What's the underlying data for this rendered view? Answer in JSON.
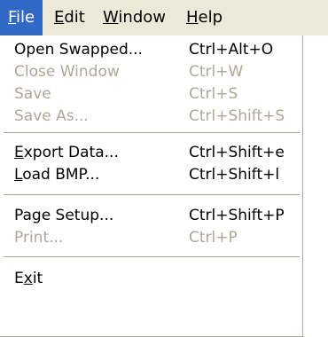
{
  "menubar": {
    "items": [
      {
        "mnemonic": "F",
        "rest": "ile"
      },
      {
        "mnemonic": "E",
        "rest": "dit"
      },
      {
        "mnemonic": "W",
        "rest": "indow"
      },
      {
        "mnemonic": "H",
        "rest": "elp"
      }
    ]
  },
  "file_menu": {
    "items": [
      {
        "label": "Open Swapped...",
        "shortcut": "Ctrl+Alt+O",
        "enabled": true
      },
      {
        "label": "Close Window",
        "shortcut": "Ctrl+W",
        "enabled": false
      },
      {
        "label": "Save",
        "shortcut": "Ctrl+S",
        "enabled": false
      },
      {
        "label": "Save As...",
        "shortcut": "Ctrl+Shift+S",
        "enabled": false
      },
      {
        "mnemonic": "E",
        "rest": "xport Data...",
        "shortcut": "Ctrl+Shift+e",
        "enabled": true
      },
      {
        "mnemonic": "L",
        "rest": "oad BMP...",
        "shortcut": "Ctrl+Shift+l",
        "enabled": true
      },
      {
        "label": "Page Setup...",
        "shortcut": "Ctrl+Shift+P",
        "enabled": true
      },
      {
        "label": "Print...",
        "shortcut": "Ctrl+P",
        "enabled": false
      },
      {
        "pre": "E",
        "mnemonic": "x",
        "rest": "it",
        "enabled": true
      }
    ]
  },
  "colors": {
    "menubar_bg": "#ece9d8",
    "highlight": "#316ac5",
    "disabled_text": "#aca899"
  }
}
